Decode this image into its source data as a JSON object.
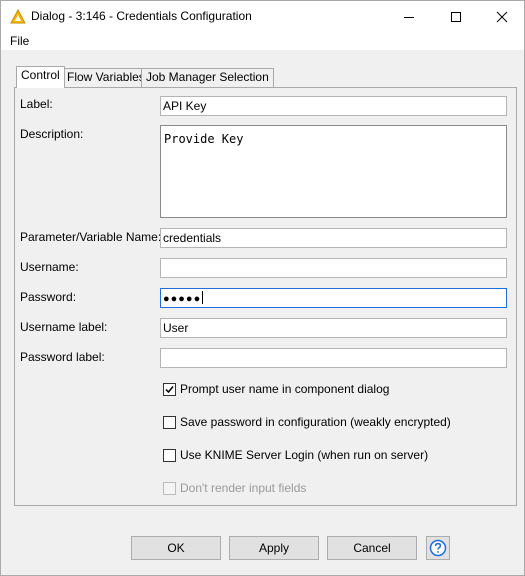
{
  "window": {
    "title": "Dialog - 3:146 - Credentials Configuration"
  },
  "menu": {
    "file": "File"
  },
  "tabs": [
    {
      "label": "Control",
      "active": true
    },
    {
      "label": "Flow Variables",
      "active": false
    },
    {
      "label": "Job Manager Selection",
      "active": false
    }
  ],
  "form": {
    "label": {
      "label": "Label:",
      "value": "API Key"
    },
    "description": {
      "label": "Description:",
      "value": "Provide Key"
    },
    "parameter": {
      "label": "Parameter/Variable Name:",
      "value": "credentials"
    },
    "username": {
      "label": "Username:",
      "value": ""
    },
    "password": {
      "label": "Password:",
      "value": "●●●●●"
    },
    "username_label": {
      "label": "Username label:",
      "value": "User"
    },
    "password_label": {
      "label": "Password label:",
      "value": ""
    }
  },
  "checkboxes": [
    {
      "label": "Prompt user name in component dialog",
      "checked": true,
      "disabled": false
    },
    {
      "label": "Save password in configuration (weakly encrypted)",
      "checked": false,
      "disabled": false
    },
    {
      "label": "Use KNIME Server Login (when run on server)",
      "checked": false,
      "disabled": false
    },
    {
      "label": "Don't render input fields",
      "checked": false,
      "disabled": true
    }
  ],
  "buttons": {
    "ok": "OK",
    "apply": "Apply",
    "cancel": "Cancel"
  },
  "icons": {
    "app": "knime-warning-triangle-icon",
    "help": "help-icon"
  },
  "colors": {
    "accent": "#1e6fd9",
    "app_icon": "#f5b800"
  }
}
